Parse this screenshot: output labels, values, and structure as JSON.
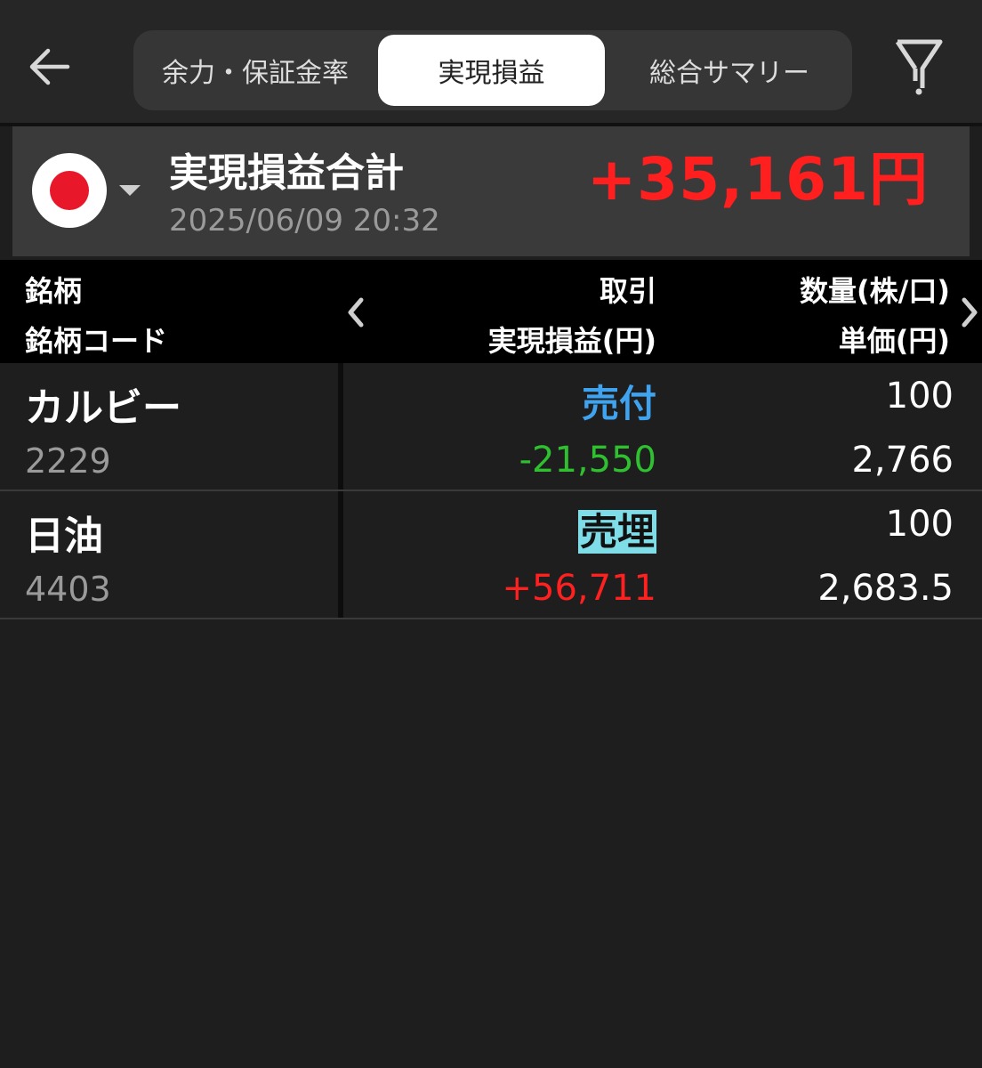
{
  "tabs": [
    {
      "label": "余力・保証金率",
      "active": false
    },
    {
      "label": "実現損益",
      "active": true
    },
    {
      "label": "総合サマリー",
      "active": false
    }
  ],
  "icons": {
    "back": "arrow-left-icon",
    "filter": "filter-icon",
    "flag": "japan-flag-icon",
    "dropdown": "caret-down-icon",
    "prev": "chevron-left-icon",
    "next": "chevron-right-icon"
  },
  "summary": {
    "title": "実現損益合計",
    "timestamp": "2025/06/09 20:32",
    "total": "+35,161円"
  },
  "columns": {
    "name": "銘柄",
    "code": "銘柄コード",
    "trade": "取引",
    "pl": "実現損益(円)",
    "qty": "数量(株/口)",
    "price": "単価(円)"
  },
  "rows": [
    {
      "name": "カルビー",
      "code": "2229",
      "trade": "売付",
      "pl": "-21,550",
      "qty": "100",
      "price": "2,766"
    },
    {
      "name": "日油",
      "code": "4403",
      "trade": "売埋",
      "pl": "+56,711",
      "qty": "100",
      "price": "2,683.5"
    }
  ],
  "colors": {
    "positive": "#ff2020",
    "negative": "#2fc02f",
    "sell": "#3fa3f0",
    "highlight": "#7fdde8"
  }
}
